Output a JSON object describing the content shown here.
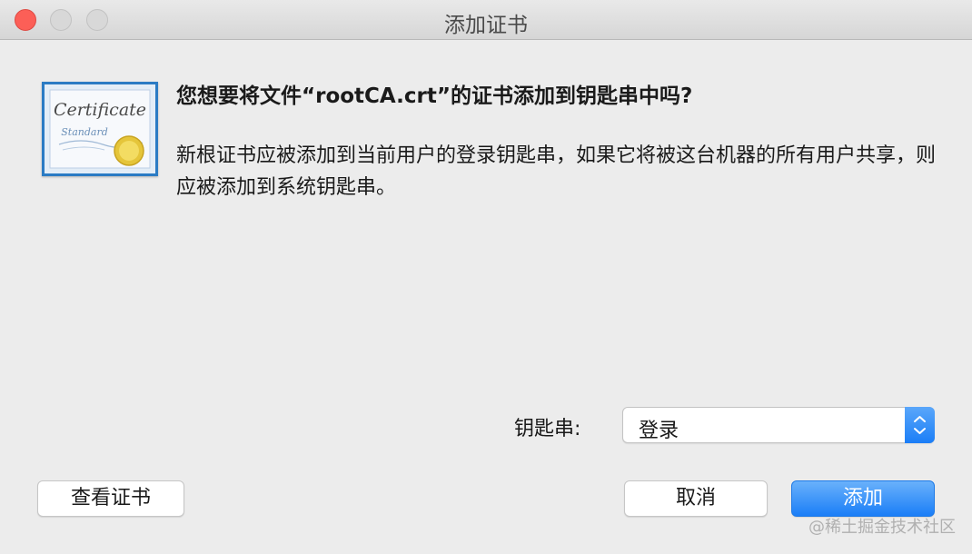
{
  "window": {
    "title": "添加证书"
  },
  "icon": {
    "name": "certificate-icon",
    "text_line1": "Certificate",
    "text_line2": "Standard"
  },
  "dialog": {
    "heading": "您想要将文件“rootCA.crt”的证书添加到钥匙串中吗?",
    "body": "新根证书应被添加到当前用户的登录钥匙串，如果它将被这台机器的所有用户共享，则应被添加到系统钥匙串。"
  },
  "keychain": {
    "label": "钥匙串:",
    "selected": "登录"
  },
  "buttons": {
    "view_certificate": "查看证书",
    "cancel": "取消",
    "add": "添加"
  },
  "watermark": "@稀土掘金技术社区",
  "colors": {
    "close_light": "#fc5f57",
    "accent": "#1b7ef7",
    "icon_border": "#2b7bc4",
    "seal": "#e5c53a"
  }
}
